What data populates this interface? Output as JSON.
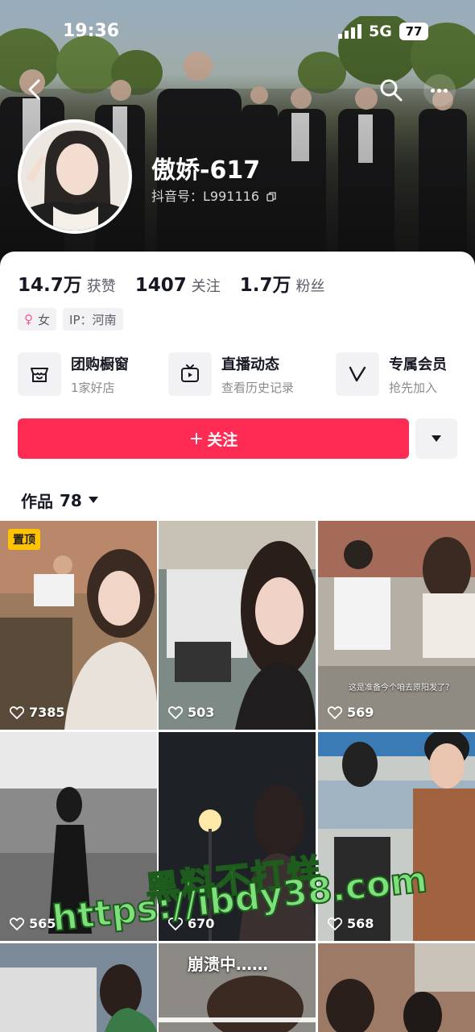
{
  "status_bar": {
    "time": "19:36",
    "network": "5G",
    "battery": "77"
  },
  "profile": {
    "name": "傲娇-617",
    "douyin_id": "抖音号：L991116",
    "stats": [
      {
        "num": "14.7万",
        "label": "获赞"
      },
      {
        "num": "1407",
        "label": "关注"
      },
      {
        "num": "1.7万",
        "label": "粉丝"
      }
    ],
    "tags": {
      "gender": "女",
      "ip": "IP：河南"
    }
  },
  "services": [
    {
      "title": "团购橱窗",
      "sub": "1家好店",
      "icon": "shop-icon"
    },
    {
      "title": "直播动态",
      "sub": "查看历史记录",
      "icon": "tv-icon"
    },
    {
      "title": "专属会员",
      "sub": "抢先加入",
      "icon": "v-membership-icon"
    }
  ],
  "actions": {
    "follow_label": "关注",
    "plus": "+"
  },
  "works": {
    "label": "作品",
    "count": "78"
  },
  "grid": {
    "items": [
      {
        "likes": "7385",
        "pinned": "置顶"
      },
      {
        "likes": "503"
      },
      {
        "likes": "569",
        "caption": "这是准备今个咱去原阳发了？"
      },
      {
        "likes": "565"
      },
      {
        "likes": "670"
      },
      {
        "likes": "568"
      },
      {
        "caption": "崩溃中……"
      }
    ]
  },
  "watermark": {
    "line1": "黑料不打烊",
    "line2": "https://ibdy38.com"
  },
  "colors": {
    "accent": "#fe2c55",
    "pin": "#ffc300",
    "female": "#f2598f"
  }
}
